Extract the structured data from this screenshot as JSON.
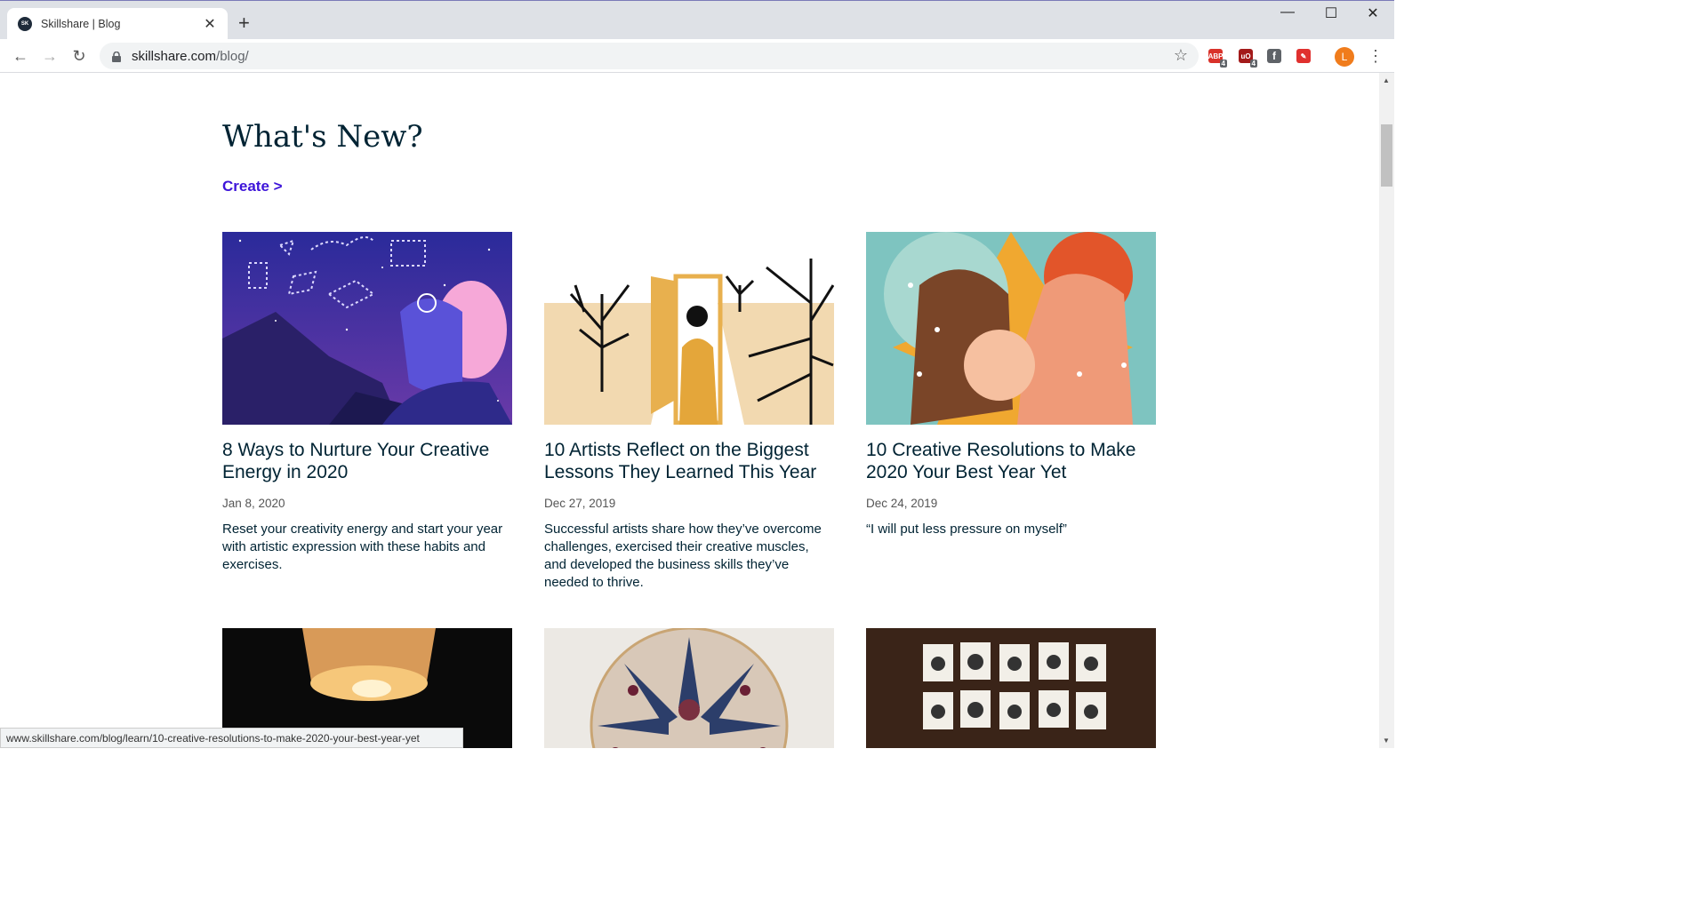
{
  "tab": {
    "title": "Skillshare | Blog",
    "favicon_text": "SK"
  },
  "toolbar": {
    "url_host": "skillshare.com",
    "url_path": "/blog/"
  },
  "extensions": [
    {
      "name": "abp",
      "label": "ABP",
      "color": "#d9322a",
      "badge": "4"
    },
    {
      "name": "ublock",
      "label": "uO",
      "color": "#a31a1a",
      "badge": "4"
    },
    {
      "name": "facebook",
      "label": "f",
      "color": "#5f6368",
      "badge": ""
    },
    {
      "name": "pin",
      "label": "P",
      "color": "#e0302e",
      "badge": ""
    }
  ],
  "avatar": {
    "initial": "L"
  },
  "page": {
    "heading": "What's New?",
    "category_link": "Create >",
    "cards": [
      {
        "title": "8 Ways to Nurture Your Creative Energy in 2020",
        "date": "Jan 8, 2020",
        "description": "Reset your creativity energy and start your year with artistic expression with these habits and exercises."
      },
      {
        "title": "10 Artists Reflect on the Biggest Lessons They Learned This Year",
        "date": "Dec 27, 2019",
        "description": "Successful artists share how they’ve overcome challenges, exercised their creative muscles, and developed the business skills they’ve needed to thrive."
      },
      {
        "title": "10 Creative Resolutions to Make 2020 Your Best Year Yet",
        "date": "Dec 24, 2019",
        "description": "“I will put less pressure on myself”"
      }
    ]
  },
  "status_bar": "www.skillshare.com/blog/learn/10-creative-resolutions-to-make-2020-your-best-year-yet"
}
